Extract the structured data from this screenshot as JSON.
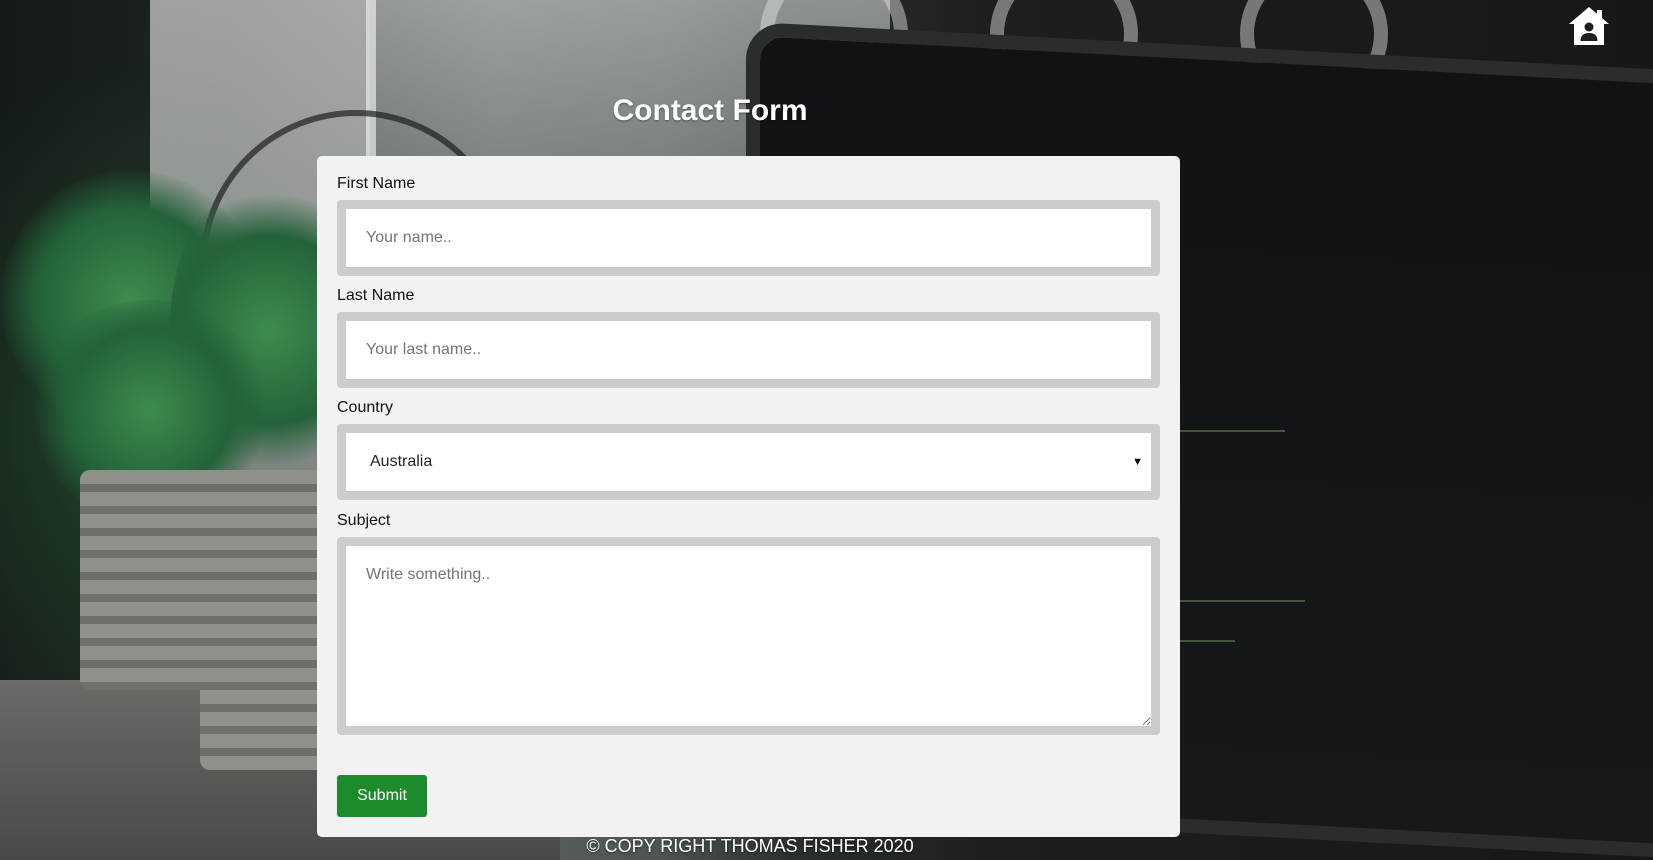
{
  "page": {
    "title": "Contact Form",
    "footer_text": "© COPY RIGHT THOMAS FISHER 2020"
  },
  "nav": {
    "home_icon": "home-icon"
  },
  "form": {
    "first_name": {
      "label": "First Name",
      "placeholder": "Your name..",
      "value": ""
    },
    "last_name": {
      "label": "Last Name",
      "placeholder": "Your last name..",
      "value": ""
    },
    "country": {
      "label": "Country",
      "selected": "Australia"
    },
    "subject": {
      "label": "Subject",
      "placeholder": "Write something..",
      "value": ""
    },
    "submit_label": "Submit"
  },
  "colors": {
    "panel_background": "#f2f2f2",
    "field_border": "#cccccc",
    "submit_button": "#1d8a2c",
    "title_text": "#ffffff"
  }
}
